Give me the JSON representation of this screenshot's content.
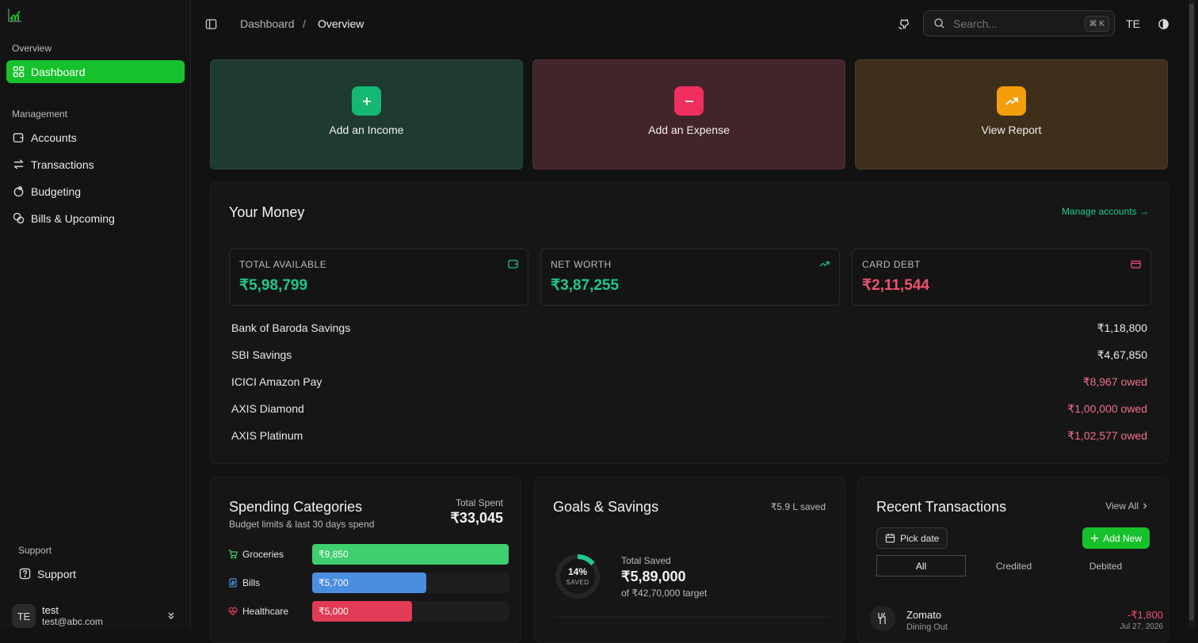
{
  "sidebar": {
    "overview_label": "Overview",
    "dashboard_label": "Dashboard",
    "management_label": "Management",
    "items": [
      {
        "label": "Accounts"
      },
      {
        "label": "Transactions"
      },
      {
        "label": "Budgeting"
      },
      {
        "label": "Bills & Upcoming"
      }
    ],
    "support_section_label": "Support",
    "support_label": "Support",
    "user": {
      "initials": "TE",
      "name": "test",
      "email": "test@abc.com"
    }
  },
  "header": {
    "breadcrumb": [
      "Dashboard",
      "/",
      "Overview"
    ],
    "search_placeholder": "Search...",
    "shortcut": "⌘ K",
    "user_initials": "TE"
  },
  "actions": [
    {
      "label": "Add an Income",
      "color": "#1f3a30",
      "icon_color": "#14b873",
      "icon": "plus-icon"
    },
    {
      "label": "Add an Expense",
      "color": "#42242b",
      "icon_color": "#f02f5e",
      "icon": "minus-icon"
    },
    {
      "label": "View Report",
      "color": "#3d2f1a",
      "icon_color": "#f59e0b",
      "icon": "trend-up-icon"
    }
  ],
  "money": {
    "title": "Your Money",
    "manage_link": "Manage accounts →",
    "stats": [
      {
        "label": "TOTAL AVAILABLE",
        "value": "₹5,98,799",
        "color": "#1ec98a"
      },
      {
        "label": "NET WORTH",
        "value": "₹3,87,255",
        "color": "#1ec98a"
      },
      {
        "label": "CARD DEBT",
        "value": "₹2,11,544",
        "color": "#f0506e"
      }
    ],
    "accounts": [
      {
        "name": "Bank of Baroda Savings",
        "amount": "₹1,18,800",
        "owed": false
      },
      {
        "name": "SBI Savings",
        "amount": "₹4,67,850",
        "owed": false
      },
      {
        "name": "ICICI Amazon Pay",
        "amount": "₹8,967 owed",
        "owed": true
      },
      {
        "name": "AXIS Diamond",
        "amount": "₹1,00,000 owed",
        "owed": true
      },
      {
        "name": "AXIS Platinum",
        "amount": "₹1,02,577 owed",
        "owed": true
      }
    ]
  },
  "spending": {
    "title": "Spending Categories",
    "subtitle": "Budget limits & last 30 days spend",
    "total_label": "Total Spent",
    "total_value": "₹33,045",
    "categories": [
      {
        "name": "Groceries",
        "amount": "₹9,850",
        "fraction": 1.0,
        "color": "#3ecf6e"
      },
      {
        "name": "Bills",
        "amount": "₹5,700",
        "fraction": 0.58,
        "color": "#4a8ee0"
      },
      {
        "name": "Healthcare",
        "amount": "₹5,000",
        "fraction": 0.51,
        "color": "#e23b55"
      }
    ]
  },
  "goals": {
    "title": "Goals & Savings",
    "saved_summary": "₹5.9 L saved",
    "percent": "14%",
    "percent_label": "SAVED",
    "fraction": 0.14,
    "total_label": "Total Saved",
    "total_value": "₹5,89,000",
    "target": "of ₹42,70,000 target"
  },
  "recent": {
    "title": "Recent Transactions",
    "view_all": "View All",
    "pick_date": "Pick date",
    "add_new": "Add New",
    "tabs": [
      "All",
      "Credited",
      "Debited"
    ],
    "items": [
      {
        "name": "Zomato",
        "category": "Dining Out",
        "amount": "-₹1,800",
        "date": "Jul 27, 2026"
      }
    ]
  },
  "colors": {
    "accent": "#17c12c",
    "positive": "#1ec98a",
    "negative": "#f0506e"
  }
}
